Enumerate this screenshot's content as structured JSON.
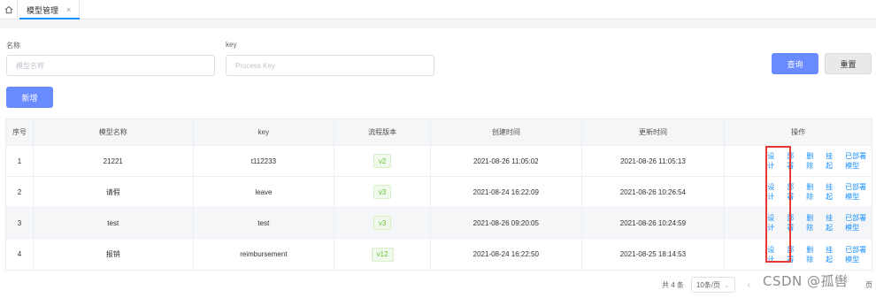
{
  "tabs": {
    "active_label": "模型管理",
    "close_label": "×"
  },
  "search": {
    "name_label": "名称",
    "name_placeholder": "模型名称",
    "key_label": "key",
    "key_placeholder": "Process Key",
    "query_button": "查询",
    "reset_button": "重置"
  },
  "toolbar": {
    "add_button": "新增"
  },
  "table": {
    "columns": [
      "序号",
      "模型名称",
      "key",
      "流程版本",
      "创建时间",
      "更新时间",
      "操作"
    ],
    "rows": [
      {
        "index": "1",
        "name": "21221",
        "key": "t112233",
        "version": "v2",
        "created": "2021-08-26 11:05:02",
        "updated": "2021-08-26 11:05:13"
      },
      {
        "index": "2",
        "name": "请假",
        "key": "leave",
        "version": "v3",
        "created": "2021-08-24 16:22:09",
        "updated": "2021-08-26 10:26:54"
      },
      {
        "index": "3",
        "name": "test",
        "key": "test",
        "version": "v3",
        "created": "2021-08-26 09:20:05",
        "updated": "2021-08-26 10:24:59"
      },
      {
        "index": "4",
        "name": "报销",
        "key": "reimbursement",
        "version": "v12",
        "created": "2021-08-24 16:22:50",
        "updated": "2021-08-25 18:14:53"
      }
    ],
    "actions": {
      "design": "设计",
      "deploy": "部署",
      "delete": "删除",
      "suspend": "挂起",
      "deployed_model": "已部署模型"
    }
  },
  "pagination": {
    "total": "共 4 条",
    "page_size": "10条/页",
    "prev": "‹",
    "next": "›",
    "suffix": "页"
  },
  "watermark": "CSDN @孤辔",
  "colors": {
    "primary": "#6a8bff",
    "link": "#1890ff",
    "tag_green": "#67c23a",
    "highlight_border": "#e53935"
  }
}
